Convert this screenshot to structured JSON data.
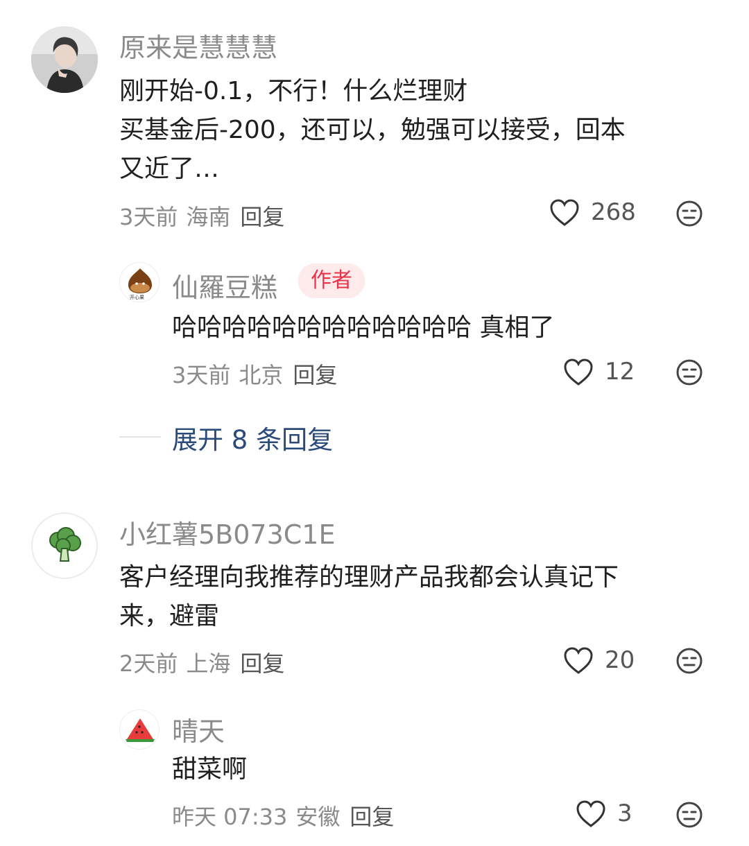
{
  "comments": [
    {
      "username": "原来是慧慧慧",
      "avatar": "person-photo-avatar",
      "lines": [
        "刚开始-0.1，不行！什么烂理财",
        "买基金后-200，还可以，勉强可以接受，回本",
        "又近了…"
      ],
      "time": "3天前",
      "location": "海南",
      "reply_label": "回复",
      "likes": "268",
      "reply": {
        "username": "仙羅豆糕",
        "avatar": "chestnut-avatar",
        "avatar_caption": "开心果",
        "badge": "作者",
        "text": "哈哈哈哈哈哈哈哈哈哈哈哈 真相了",
        "time": "3天前",
        "location": "北京",
        "reply_label": "回复",
        "likes": "12"
      },
      "expand_label": "展开 8 条回复"
    },
    {
      "username": "小红薯5B073C1E",
      "avatar": "broccoli-avatar",
      "lines": [
        "客户经理向我推荐的理财产品我都会认真记下",
        "来，避雷"
      ],
      "time": "2天前",
      "location": "上海",
      "reply_label": "回复",
      "likes": "20",
      "reply": {
        "username": "晴天",
        "avatar": "watermelon-avatar",
        "text": "甜菜啊",
        "time": "昨天 07:33",
        "location": "安徽",
        "reply_label": "回复",
        "likes": "3"
      }
    }
  ],
  "colors": {
    "name_gray": "#8a8a8a",
    "badge_bg": "#fdeaea",
    "badge_text": "#e8334a",
    "expand_blue": "#2a4a7a"
  }
}
